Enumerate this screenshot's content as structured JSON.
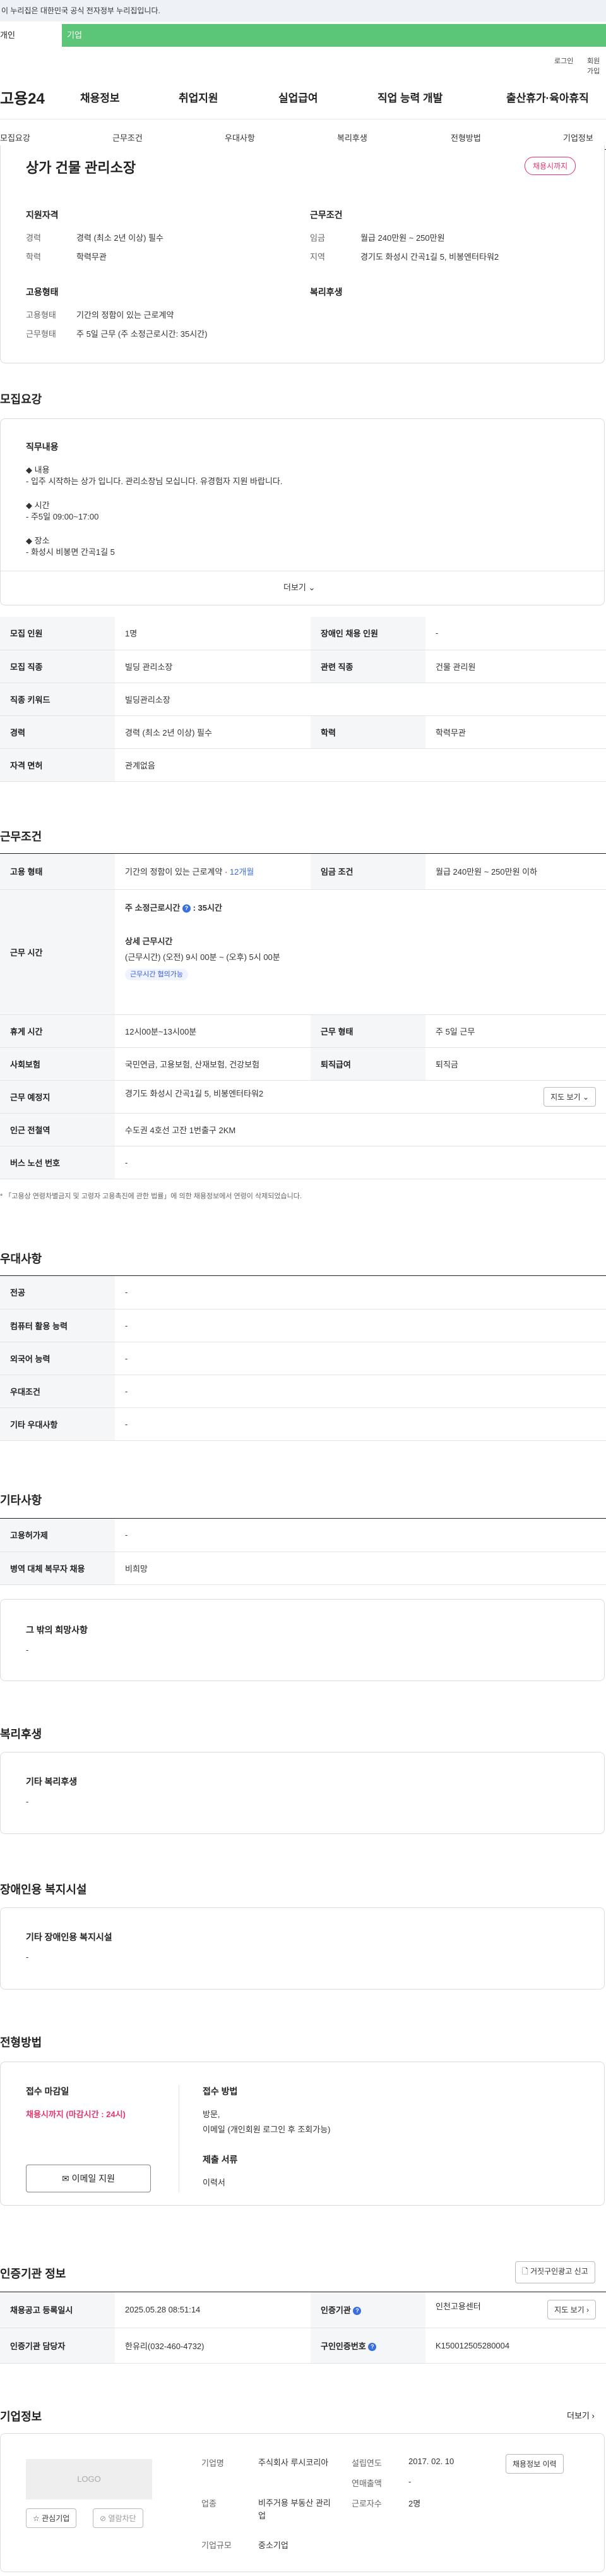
{
  "gov_notice": "이 누리집은 대한민국 공식 전자정부 누리집입니다.",
  "tabs": {
    "person": "개인",
    "company": "기업"
  },
  "util": {
    "login": "로그인",
    "signup": "회원가입"
  },
  "logo": "고용24",
  "gnb": [
    "채용정보",
    "취업지원",
    "실업급여",
    "직업 능력 개발",
    "출산휴가·육아휴직"
  ],
  "subnav": [
    "모집요강",
    "근무조건",
    "우대사항",
    "복리후생",
    "전형방법",
    "기업정보"
  ],
  "summary": {
    "title": "상가 건물 관리소장",
    "badge": "채용시까지",
    "qual_title": "지원자격",
    "career_k": "경력",
    "career_v": "경력 (최소 2년 이상) 필수",
    "edu_k": "학력",
    "edu_v": "학력무관",
    "cond_title": "근무조건",
    "wage_k": "임금",
    "wage_v": "월급 240만원 ~ 250만원",
    "region_k": "지역",
    "region_v": "경기도 화성시 간곡1길 5, 비봉엔터타워2",
    "emp_title": "고용형태",
    "emptype_k": "고용형태",
    "emptype_v": "기간의 정함이 있는 근로계약",
    "worktype_k": "근무형태",
    "worktype_v": "주 5일 근무 (주 소정근로시간: 35시간)",
    "welfare_title": "복리후생"
  },
  "recruit": {
    "section_title": "모집요강",
    "duty_title": "직무내용",
    "duty_lines": [
      "◆ 내용",
      "- 입주 시작하는 상가 입니다. 관리소장님 모십니다. 유경험자 지원 바랍니다.",
      "◆ 시간",
      "- 주5일 09:00~17:00",
      "◆ 장소",
      "- 화성시 비봉면 간곡1길 5"
    ],
    "more": "더보기",
    "rows": [
      [
        "모집 인원",
        "1명",
        "장애인 채용 인원",
        "-"
      ],
      [
        "모집 직종",
        "빌딩 관리소장",
        "관련 직종",
        "건물 관리원"
      ],
      [
        "직종 키워드",
        "빌딩관리소장",
        "",
        ""
      ],
      [
        "경력",
        "경력 (최소 2년 이상) 필수",
        "학력",
        "학력무관"
      ],
      [
        "자격 면허",
        "관계없음",
        "",
        ""
      ]
    ]
  },
  "work": {
    "section_title": "근무조건",
    "emp_k": "고용 형태",
    "emp_v": "기간의 정함이 있는 근로계약 · ",
    "emp_months": "12개월",
    "wage_k": "임금 조건",
    "wage_v": "월급 240만원 ~ 250만원 이하",
    "time_k": "근무 시간",
    "weekly_label": "주 소정근로시간",
    "weekly_v": ": 35시간",
    "detail_title": "상세 근무시간",
    "detail_v": "(근무시간) (오전) 9시 00분 ~ (오후) 5시 00분",
    "negotiable": "근무시간 협의가능",
    "rest_k": "휴게 시간",
    "rest_v": "12시00분~13시00분",
    "form_k": "근무 형태",
    "form_v": "주 5일 근무",
    "ins_k": "사회보험",
    "ins_v": "국민연금, 고용보험, 산재보험, 건강보험",
    "sev_k": "퇴직급여",
    "sev_v": "퇴직금",
    "place_k": "근무 예정지",
    "place_v": "경기도 화성시 간곡1길 5, 비봉엔터타워2",
    "map_btn": "지도 보기",
    "station_k": "인근 전철역",
    "station_v": "수도권 4호선 고잔 1번출구 2KM",
    "bus_k": "버스 노선 번호",
    "bus_v": "-",
    "note": "* 「고용상 연령차별금지 및 고령자 고용촉진에 관한 법률」에 의한 채용정보에서 연령이 삭제되었습니다."
  },
  "pref": {
    "section_title": "우대사항",
    "rows": [
      [
        "전공",
        "-"
      ],
      [
        "컴퓨터 활용 능력",
        "-"
      ],
      [
        "외국어 능력",
        "-"
      ],
      [
        "우대조건",
        "-"
      ],
      [
        "기타 우대사항",
        "-"
      ]
    ]
  },
  "other": {
    "section_title": "기타사항",
    "rows": [
      [
        "고용허가제",
        "-"
      ],
      [
        "병역 대체 복무자 채용",
        "비희망"
      ]
    ],
    "wish_title": "그 밖의 희망사항",
    "wish_v": "-"
  },
  "benefit": {
    "section_title": "복리후생",
    "box_title": "기타 복리후생",
    "box_v": "-"
  },
  "disability": {
    "section_title": "장애인용 복지시설",
    "box_title": "기타 장애인용 복지시설",
    "box_v": "-"
  },
  "selection": {
    "section_title": "전형방법",
    "deadline_title": "접수 마감일",
    "deadline_v": "채용시까지 (마감시간 : 24시)",
    "apply_btn": "이메일 지원",
    "method_title": "접수 방법",
    "method_v1": "방문,",
    "method_v2": "이메일 (개인회원 로그인 후 조회가능)",
    "docs_title": "제출 서류",
    "docs_v": "이력서"
  },
  "auth": {
    "section_title": "인증기관 정보",
    "report_btn": "거짓구인광고 신고",
    "reg_k": "채용공고 등록일시",
    "reg_v": "2025.05.28 08:51:14",
    "org_k": "인증기관",
    "org_v": "인천고용센터",
    "map_btn": "지도 보기",
    "mgr_k": "인증기관 담당자",
    "mgr_v": "한유리(032-460-4732)",
    "num_k": "구인인증번호",
    "num_v": "K150012505280004"
  },
  "company": {
    "section_title": "기업정보",
    "more": "더보기",
    "logo_text": "LOGO",
    "fav_btn": "관심기업",
    "block_btn": "열람차단",
    "name_k": "기업명",
    "name_v": "주식회사 루시코리아",
    "biz_k": "업종",
    "biz_v": "비주거용 부동산 관리업",
    "size_k": "기업규모",
    "size_v": "중소기업",
    "est_k": "설립연도",
    "est_v": "2017. 02. 10",
    "sales_k": "연매출액",
    "sales_v": "-",
    "staff_k": "근로자수",
    "staff_v": "2명",
    "hist_btn": "채용정보 이력"
  }
}
